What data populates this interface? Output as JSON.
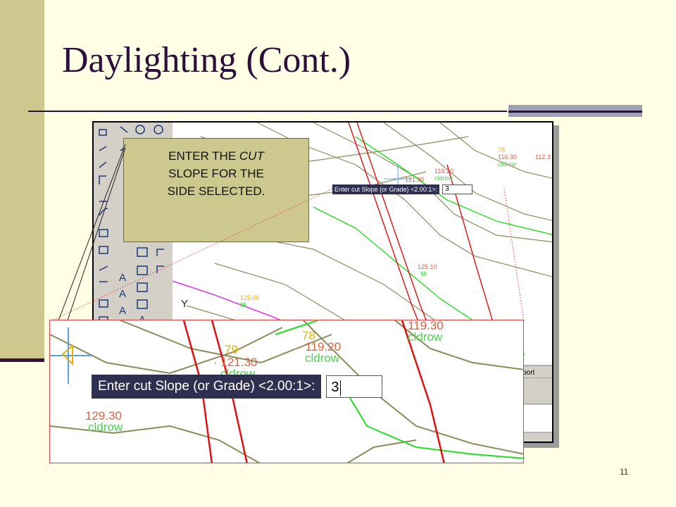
{
  "slide": {
    "title": "Daylighting (Cont.)",
    "page_number": "11"
  },
  "callout": {
    "lines": [
      "ENTER THE ",
      "CUT",
      " SLOPE FOR THE",
      "SIDE  SELECTED."
    ]
  },
  "command": {
    "prompt_label": "Enter cut Slope (or Grade) <2.00:1>:",
    "input_value": "3"
  },
  "drawing": {
    "labels_small": [
      {
        "text": "116.30"
      },
      {
        "text": "cldrow"
      },
      {
        "text": "78"
      },
      {
        "text": "112.3"
      },
      {
        "text": "119.20"
      },
      {
        "text": "cldrow"
      },
      {
        "text": "121.30"
      },
      {
        "text": "125.10"
      },
      {
        "text": "fill"
      },
      {
        "text": "125.00"
      },
      {
        "text": "fill"
      }
    ],
    "labels_zoom": [
      {
        "text": "78"
      },
      {
        "text": "· 119.20"
      },
      {
        "text": "cldrow"
      },
      {
        "text": "79"
      },
      {
        "text": "· 121.30"
      },
      {
        "text": "cldrow"
      },
      {
        "text": "119.30"
      },
      {
        "text": "cldrow"
      },
      {
        "text": "129.30"
      },
      {
        "text": "cldrow"
      }
    ],
    "port_tab": "port",
    "toolbar_letters": [
      "A",
      "A",
      "A",
      "A"
    ],
    "axis_letter": "Y"
  },
  "colors": {
    "background": "#FFFFE5",
    "band": "#CDC88E",
    "title": "#2E0F3B",
    "prompt_bg": "#2F2F4F",
    "contour": "#8B8B5A",
    "road_red": "#E01010",
    "green_line": "#22DD22",
    "magenta_line": "#E020E0"
  },
  "icons": [
    "command-prompt",
    "ucs-crosshair-icon",
    "toolbar-draw-icons"
  ]
}
